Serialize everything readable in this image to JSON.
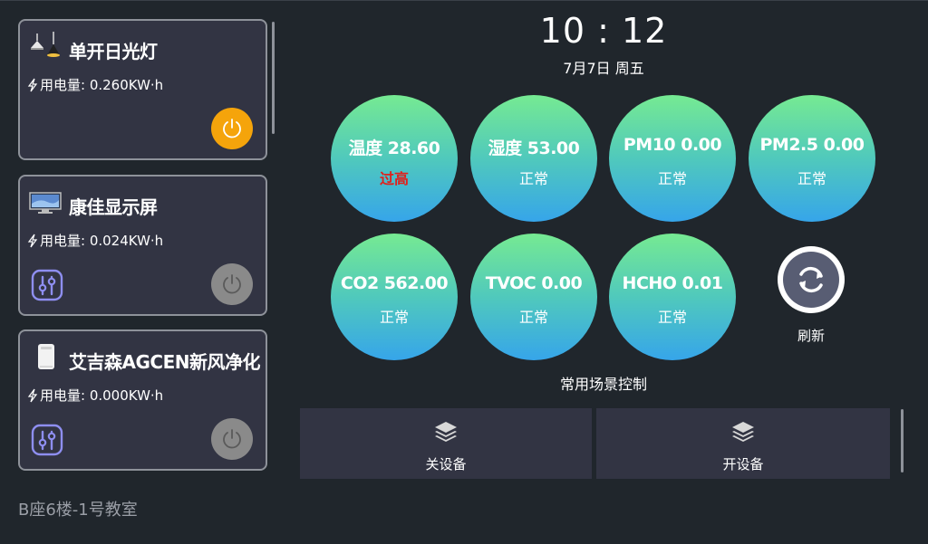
{
  "header": {
    "time": "10 : 12",
    "date": "7月7日 周五"
  },
  "devices": [
    {
      "name": "单开日光灯",
      "power_label": "用电量: 0.260KW·h",
      "icon": "ceiling-lamp-icon",
      "state": "on"
    },
    {
      "name": "康佳显示屏",
      "power_label": "用电量: 0.024KW·h",
      "icon": "monitor-icon",
      "state": "off"
    },
    {
      "name": "艾吉森AGCEN新风净化",
      "power_label": "用电量: 0.000KW·h",
      "icon": "air-purifier-icon",
      "state": "off"
    }
  ],
  "location": "B座6楼-1号教室",
  "sensors": [
    {
      "label": "温度 28.60",
      "status": "过高",
      "alert": true
    },
    {
      "label": "湿度 53.00",
      "status": "正常"
    },
    {
      "label": "PM10 0.00",
      "status": "正常"
    },
    {
      "label": "PM2.5 0.00",
      "status": "正常"
    },
    {
      "label": "CO2 562.00",
      "status": "正常"
    },
    {
      "label": "TVOC 0.00",
      "status": "正常"
    },
    {
      "label": "HCHO 0.01",
      "status": "正常"
    }
  ],
  "refresh_label": "刷新",
  "scene": {
    "title": "常用场景控制",
    "buttons": [
      {
        "label": "关设备",
        "icon": "layers-icon"
      },
      {
        "label": "开设备",
        "icon": "layers-icon"
      }
    ]
  },
  "colors": {
    "background": "#20262c",
    "card": "#323443",
    "power_on": "#f5a40b",
    "power_off": "#8a8a8a",
    "alert": "#e0201c",
    "gradient_top": "#76ea92",
    "gradient_bottom": "#36a5ea"
  }
}
